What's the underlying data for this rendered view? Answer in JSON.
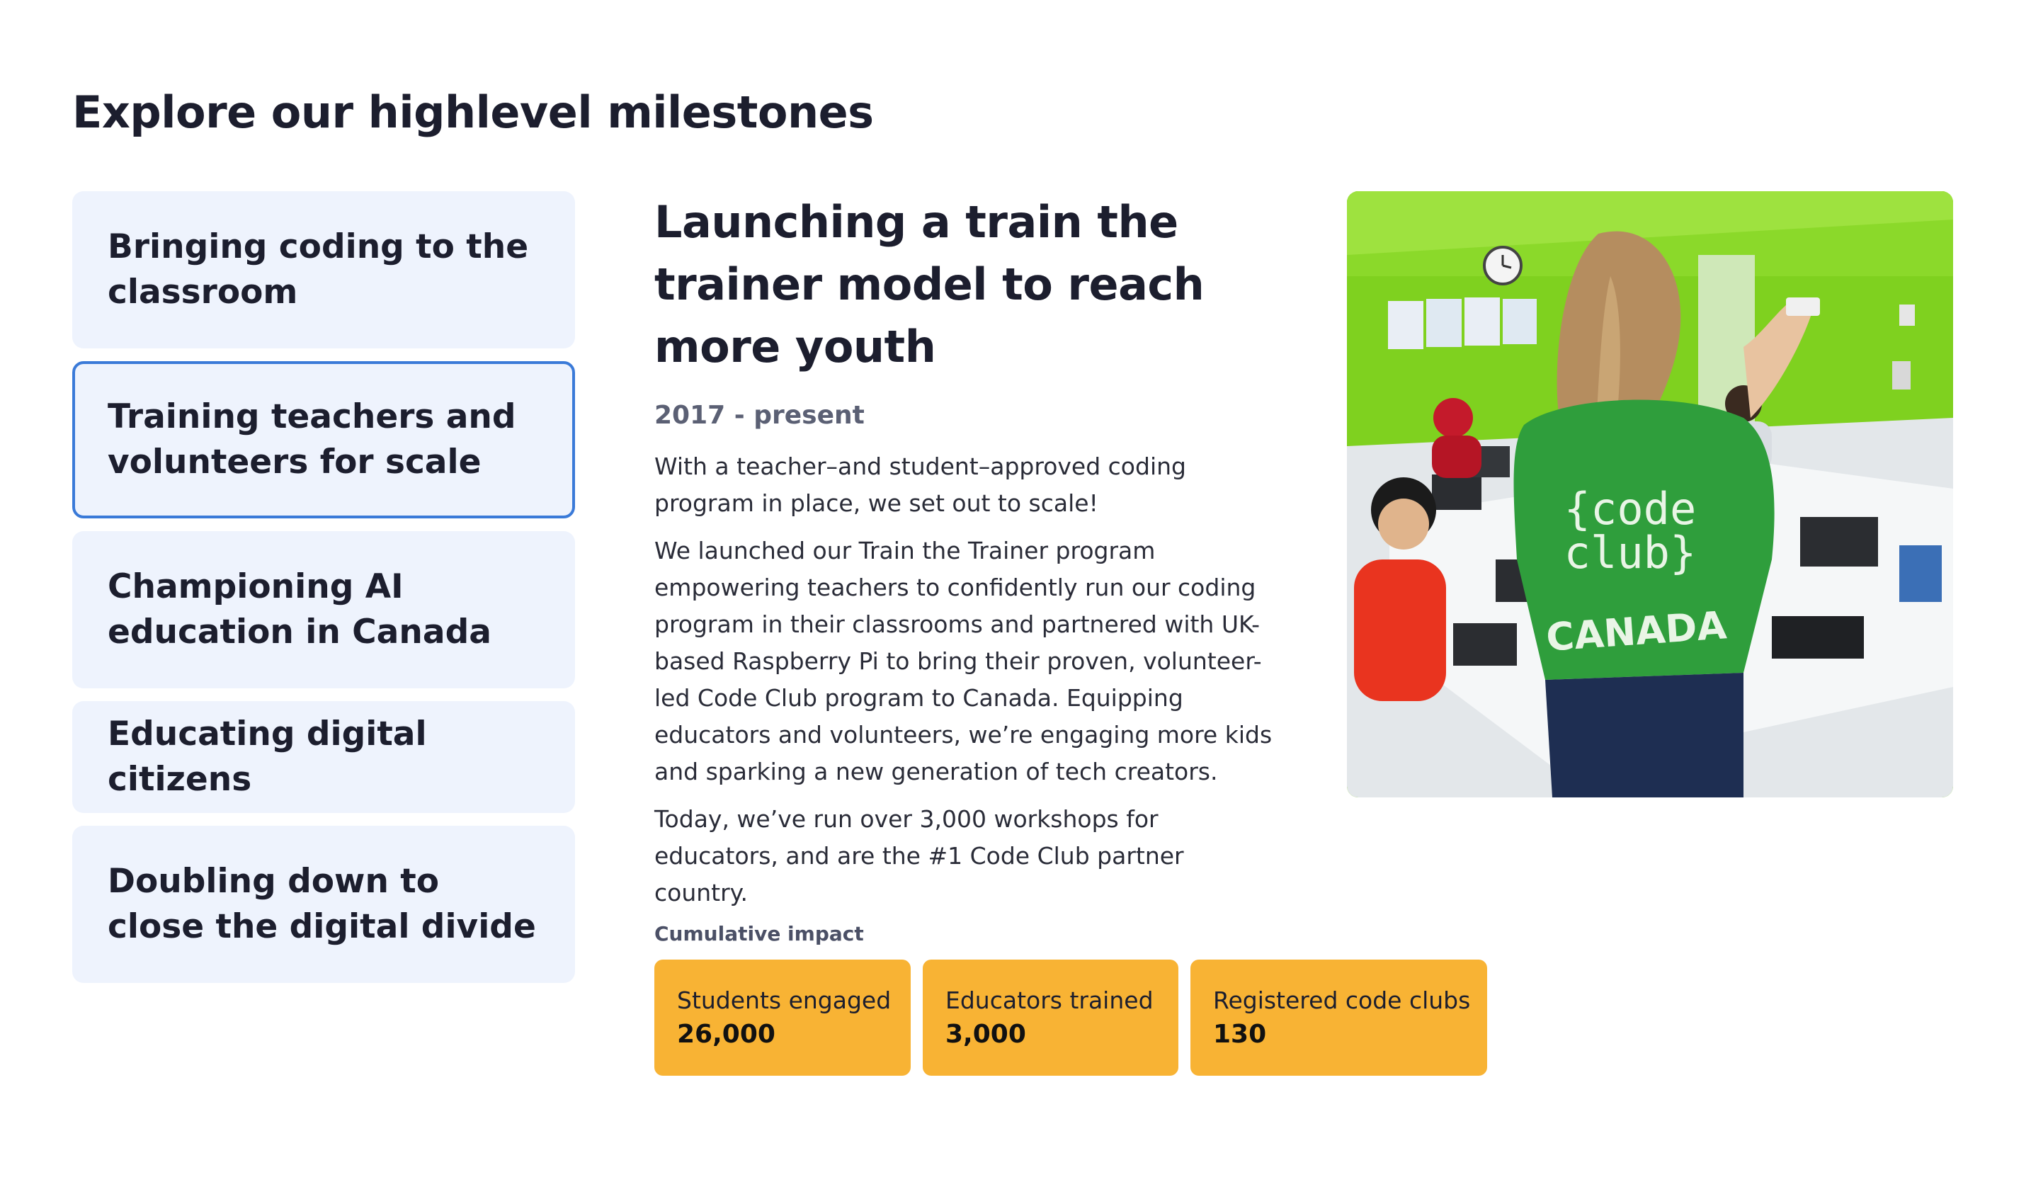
{
  "page": {
    "title": "Explore our highlevel milestones"
  },
  "milestones": [
    {
      "label": "Bringing coding to the classroom",
      "active": false
    },
    {
      "label": "Training teachers and volunteers for scale",
      "active": true
    },
    {
      "label": "Championing AI education in Canada",
      "active": false
    },
    {
      "label": "Educating digital citizens",
      "active": false
    },
    {
      "label": "Doubling down to close the digital divide",
      "active": false
    }
  ],
  "detail": {
    "title": "Launching a train the trainer model to reach more youth",
    "period": "2017 - present",
    "paragraphs": [
      "With a teacher–and student–approved coding program in place, we set out to scale!",
      "We launched our Train the Trainer program empowering teachers to confidently run our coding program in their classrooms and partnered with UK-based Raspberry Pi to bring their proven, volunteer-led Code Club program to Canada. Equipping educators and volunteers, we’re engaging more kids and sparking a new generation of tech creators.",
      "Today, we’ve run over 3,000 workshops for educators, and are the #1 Code Club partner country."
    ]
  },
  "impact": {
    "heading": "Cumulative impact",
    "cards": [
      {
        "label": "Students engaged",
        "value": "26,000"
      },
      {
        "label": "Educators trained",
        "value": "3,000"
      },
      {
        "label": "Registered code clubs",
        "value": "130"
      }
    ]
  },
  "photo": {
    "shirt_text": [
      "{code",
      "club}",
      "CANADA"
    ]
  },
  "colors": {
    "active_border": "#3a7ad8",
    "milestone_bg": "#eef3fd",
    "impact_card_bg": "#f8b334",
    "wall_green": "#7fd11f",
    "shirt_green": "#2f9e3c"
  }
}
